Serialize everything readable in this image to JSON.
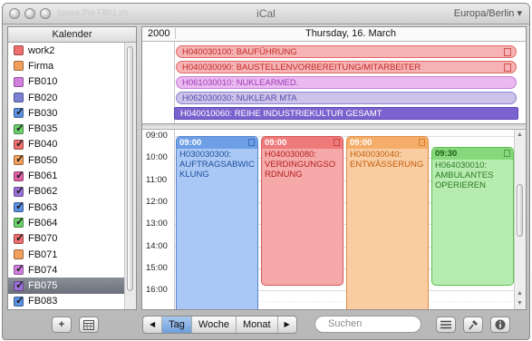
{
  "window": {
    "title": "iCal",
    "timezone": "Europa/Berlin ▾",
    "background_tabs": "Space Pro   FB01.ch"
  },
  "sidebar": {
    "header": "Kalender",
    "calendars": [
      {
        "name": "work2",
        "color": "#ef6f6f",
        "checked": false
      },
      {
        "name": "Firma",
        "color": "#f3a05c",
        "checked": false
      },
      {
        "name": "FB010",
        "color": "#d27fe0",
        "checked": false
      },
      {
        "name": "FB020",
        "color": "#7b82d4",
        "checked": false
      },
      {
        "name": "FB030",
        "color": "#5b8fe0",
        "checked": true
      },
      {
        "name": "FB035",
        "color": "#6bd06b",
        "checked": true
      },
      {
        "name": "FB040",
        "color": "#ef6f6f",
        "checked": true
      },
      {
        "name": "FB050",
        "color": "#f3a05c",
        "checked": true
      },
      {
        "name": "FB061",
        "color": "#e05fa5",
        "checked": true
      },
      {
        "name": "FB062",
        "color": "#9a6fd8",
        "checked": true
      },
      {
        "name": "FB063",
        "color": "#5b8fe0",
        "checked": true
      },
      {
        "name": "FB064",
        "color": "#6bd06b",
        "checked": true
      },
      {
        "name": "FB070",
        "color": "#ef6f6f",
        "checked": true
      },
      {
        "name": "FB071",
        "color": "#f3a05c",
        "checked": false
      },
      {
        "name": "FB074",
        "color": "#d27fe0",
        "checked": true
      },
      {
        "name": "FB075",
        "color": "#9a6fd8",
        "checked": true,
        "selected": true
      },
      {
        "name": "FB083",
        "color": "#5b8fe0",
        "checked": true
      }
    ]
  },
  "main": {
    "year": "2000",
    "date_label": "Thursday, 16. March",
    "allday_events": [
      {
        "title": "H040030100: BAUFÜHRUNG",
        "bg": "#f7b3b3",
        "border": "#e06a6a",
        "text": "#c02a2a"
      },
      {
        "title": "H040030090: BAUSTELLENVORBEREITUNG/MITARBEITER",
        "bg": "#f7b3b3",
        "border": "#e06a6a",
        "text": "#c02a2a"
      },
      {
        "title": "H061030010: NUKLEARMED.",
        "bg": "#eab9f0",
        "border": "#c77fd6",
        "text": "#a13cb6"
      },
      {
        "title": "H062030030: NUKLEAR MTA",
        "bg": "#cbc3ea",
        "border": "#8f82cc",
        "text": "#5b4ca8"
      },
      {
        "title": "H040010060: REIHE INDUSTRIEKULTUR GESAMT",
        "bg": "#7a62cf",
        "border": "#5d47b2",
        "text": "#ffffff"
      }
    ],
    "hours": [
      "09:00",
      "10:00",
      "11:00",
      "12:00",
      "13:00",
      "14:00",
      "15:00",
      "16:00"
    ],
    "events": [
      {
        "time": "09:00",
        "title": "H030030300: AUFTRAGSABWICKLUNG",
        "bg": "#a9c8f5",
        "head": "#6e9fe6",
        "border": "#5a86cc",
        "text": "#1f4f9c"
      },
      {
        "time": "09:00",
        "title": "H040030080: VERDINGUNGSORDNUNG",
        "bg": "#f6a9a9",
        "head": "#ee7a7a",
        "border": "#d25757",
        "text": "#b21f1f"
      },
      {
        "time": "09:00",
        "title": "H040030040: ENTWÄSSERUNG",
        "bg": "#f9cca2",
        "head": "#f5ad6a",
        "border": "#e08d45",
        "text": "#c4600c"
      },
      {
        "time": "09:30",
        "title": "H064030010: AMBULANTES OPERIEREN",
        "bg": "#b7ecb0",
        "head": "#86d97b",
        "border": "#5ebd52",
        "text": "#2c7a23"
      }
    ]
  },
  "toolbar": {
    "add_label": "+",
    "view_tabs": [
      {
        "label": "Tag",
        "active": true
      },
      {
        "label": "Woche",
        "active": false
      },
      {
        "label": "Monat",
        "active": false
      }
    ],
    "prev_label": "◀",
    "next_label": "▶",
    "search_placeholder": "Suchen"
  }
}
